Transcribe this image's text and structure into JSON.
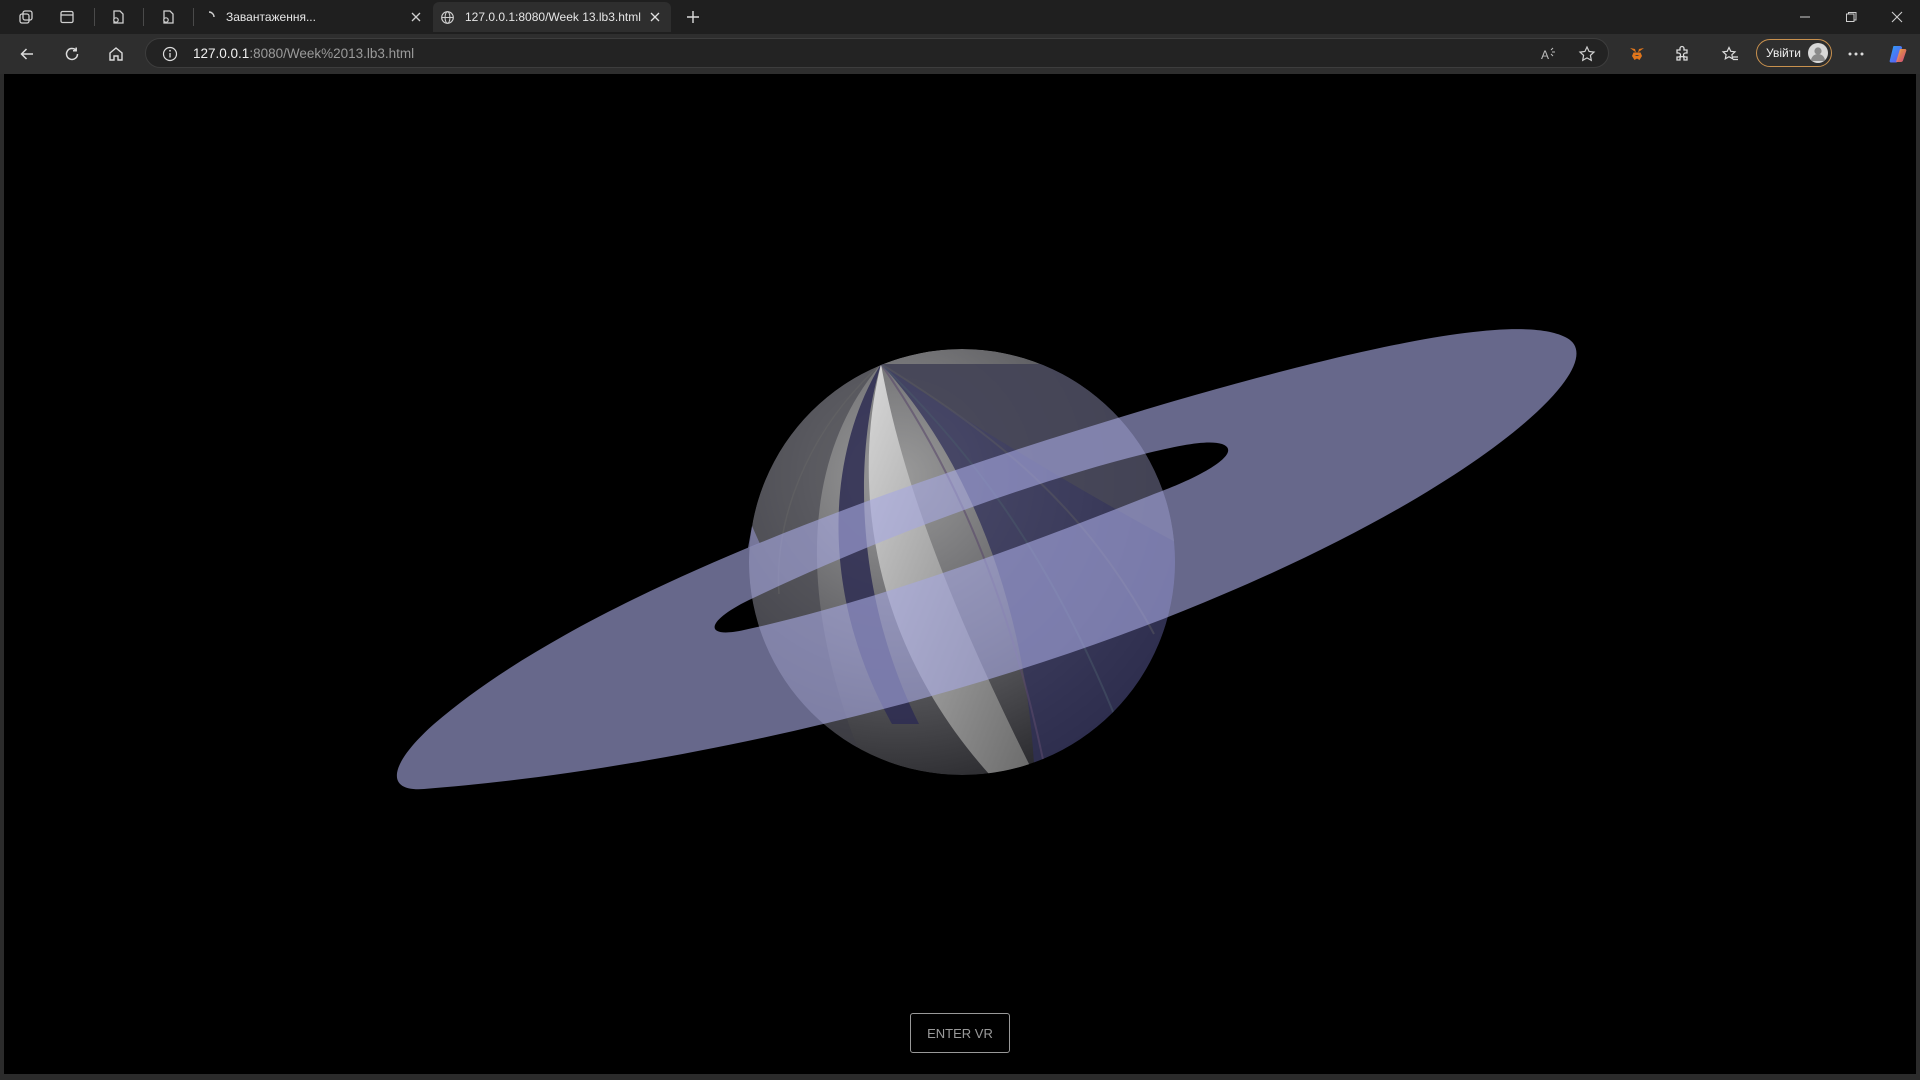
{
  "tabs": [
    {
      "title": "Завантаження...",
      "active": false
    },
    {
      "title": "127.0.0.1:8080/Week 13.lb3.html",
      "active": true
    }
  ],
  "addressbar": {
    "url_host": "127.0.0.1",
    "url_rest": ":8080/Week%2013.lb3.html"
  },
  "toolbar": {
    "signin_label": "Увійти"
  },
  "page": {
    "enter_vr_label": "ENTER VR"
  },
  "colors": {
    "background": "#000000",
    "ring": "#a6a8e0",
    "planet_light": "#a8a8a8",
    "planet_dark": "#2a2a52",
    "signin_border": "#c9914e"
  },
  "icons": [
    "workspaces-icon",
    "tab-actions-icon",
    "collection-icon",
    "page-icon",
    "globe-icon",
    "close-icon",
    "new-tab-icon",
    "minimize-icon",
    "restore-icon",
    "window-close-icon",
    "back-icon",
    "refresh-icon",
    "home-icon",
    "info-icon",
    "read-aloud-icon",
    "favorite-star-icon",
    "metamask-icon",
    "extensions-icon",
    "favorites-icon",
    "more-icon",
    "copilot-icon"
  ]
}
